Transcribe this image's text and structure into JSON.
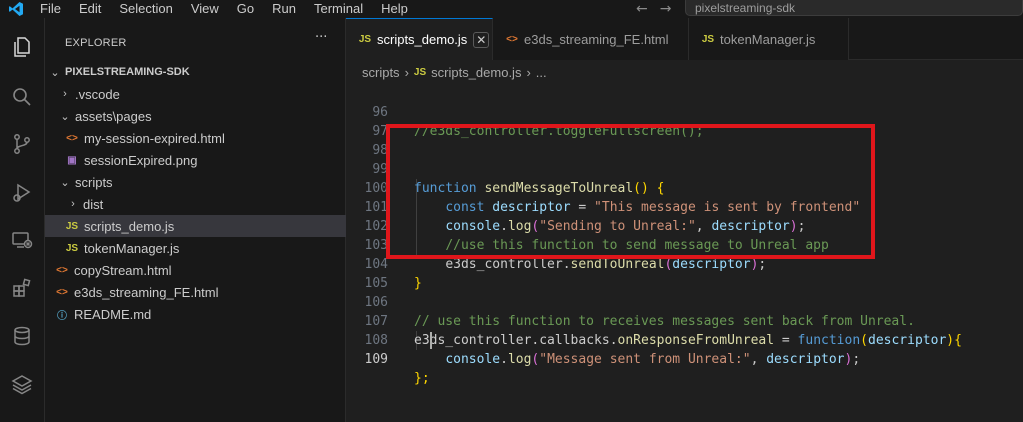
{
  "menu": [
    "File",
    "Edit",
    "Selection",
    "View",
    "Go",
    "Run",
    "Terminal",
    "Help"
  ],
  "nav": {
    "back": "←",
    "forward": "→"
  },
  "search": {
    "text": "pixelstreaming-sdk"
  },
  "activity_bar": [
    "explorer-icon",
    "search-icon",
    "source-control-icon",
    "run-debug-icon",
    "remote-explorer-icon",
    "extensions-icon",
    "database-icon",
    "layers-icon"
  ],
  "explorer": {
    "title": "EXPLORER",
    "more": "···",
    "items": [
      {
        "label": "PIXELSTREAMING-SDK",
        "icon": "",
        "chevron": "⌄"
      },
      {
        "label": ".vscode",
        "icon": "",
        "chevron": "›"
      },
      {
        "label": "assets\\pages",
        "icon": "",
        "chevron": "⌄"
      },
      {
        "label": "my-session-expired.html",
        "icon": "<>",
        "chevron": ""
      },
      {
        "label": "sessionExpired.png",
        "icon": "▣",
        "chevron": ""
      },
      {
        "label": "scripts",
        "icon": "",
        "chevron": "⌄"
      },
      {
        "label": "dist",
        "icon": "",
        "chevron": "›"
      },
      {
        "label": "scripts_demo.js",
        "icon": "JS",
        "chevron": ""
      },
      {
        "label": "tokenManager.js",
        "icon": "JS",
        "chevron": ""
      },
      {
        "label": "copyStream.html",
        "icon": "<>",
        "chevron": ""
      },
      {
        "label": "e3ds_streaming_FE.html",
        "icon": "<>",
        "chevron": ""
      },
      {
        "label": "README.md",
        "icon": "ⓘ",
        "chevron": ""
      }
    ]
  },
  "tabs": [
    {
      "label": "scripts_demo.js",
      "icon": "JS",
      "close": "✕"
    },
    {
      "label": "e3ds_streaming_FE.html",
      "icon": "<>"
    },
    {
      "label": "tokenManager.js",
      "icon": "JS"
    }
  ],
  "breadcrumb": {
    "folder": "scripts",
    "sep1": "›",
    "icon": "JS",
    "file": "scripts_demo.js",
    "sep2": "›",
    "more": "..."
  },
  "code": {
    "line_numbers": [
      "96",
      "97",
      "98",
      "99",
      "100",
      "101",
      "102",
      "103",
      "104",
      "105",
      "106",
      "107",
      "108",
      "109"
    ],
    "l96": "//e3ds_controller.toggleFullscreen();",
    "l99_kw": "function",
    "l99_fn": "sendMessageToUnreal",
    "l99_paren": "()",
    "l99_brace": "{",
    "l100_kw": "const",
    "l100_var": "descriptor",
    "l100_eq": " = ",
    "l100_str": "\"This message is sent by frontend\"",
    "l101_obj": "console",
    "l101_fn": "log",
    "l101_str": "\"Sending to Unreal:\"",
    "l101_var": "descriptor",
    "l102": "//use this function to send message to Unreal app",
    "l103_obj": "e3ds_controller",
    "l103_fn": "sendToUnreal",
    "l103_var": "descriptor",
    "l104": "}",
    "l106": "// use this function to receives messages sent back from Unreal.",
    "l107_obj": "e3ds_controller",
    "l107_prop": "callbacks",
    "l107_fnprop": "onResponseFromUnreal",
    "l107_kw": "function",
    "l107_param": "descriptor",
    "l108_obj": "console",
    "l108_fn": "log",
    "l108_str": "\"Message sent from Unreal:\"",
    "l108_var": "descriptor",
    "l109": "};"
  },
  "colors": {
    "highlight_box": "#e0161b",
    "accent": "#0078d4"
  }
}
